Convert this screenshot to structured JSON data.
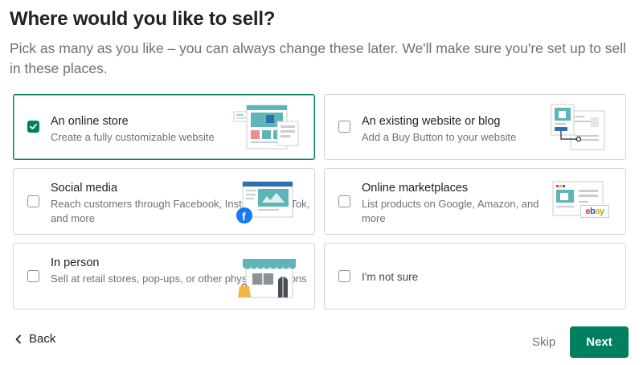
{
  "header": {
    "title": "Where would you like to sell?",
    "subtitle": "Pick as many as you like – you can always change these later. We'll make sure you're set up to sell in these places."
  },
  "options": [
    {
      "title": "An online store",
      "description": "Create a fully customizable website",
      "checked": true,
      "icon": "online-store-illustration"
    },
    {
      "title": "An existing website or blog",
      "description": "Add a Buy Button to your website",
      "checked": false,
      "icon": "website-blog-illustration"
    },
    {
      "title": "Social media",
      "description": "Reach customers through Facebook, Instagram, TikTok, and more",
      "checked": false,
      "icon": "social-media-illustration"
    },
    {
      "title": "Online marketplaces",
      "description": "List products on Google, Amazon, and more",
      "checked": false,
      "icon": "marketplaces-illustration",
      "badge": "ebay"
    },
    {
      "title": "In person",
      "description": "Sell at retail stores, pop-ups, or other physical locations",
      "checked": false,
      "icon": "storefront-illustration"
    },
    {
      "title": "I'm not sure",
      "description": "",
      "checked": false
    }
  ],
  "footer": {
    "back_label": "Back",
    "skip_label": "Skip",
    "next_label": "Next"
  },
  "colors": {
    "accent": "#008060",
    "border": "#d2d5d8",
    "muted_text": "#6d7175",
    "illustration_teal": "#5fb4b6"
  }
}
